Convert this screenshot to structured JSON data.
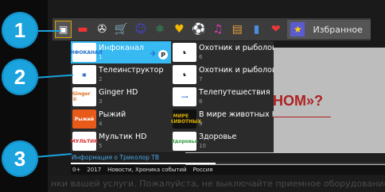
{
  "background": {
    "heading": "КОНОМ»?",
    "ticker": "нки вашей услуги. Пожалуйста, не выключайте приемное оборудование в тече"
  },
  "category_bar": {
    "items": [
      {
        "icon": "tv-icon",
        "glyph": "▣"
      },
      {
        "icon": "russia-flag-icon",
        "glyph": "▬"
      },
      {
        "icon": "film-reel-icon",
        "glyph": "✇"
      },
      {
        "icon": "shopping-cart-icon",
        "glyph": "🛒"
      },
      {
        "icon": "theater-mask-icon",
        "glyph": "☺"
      },
      {
        "icon": "atom-icon",
        "glyph": "⚛"
      },
      {
        "icon": "ice-cream-icon",
        "glyph": "♥"
      },
      {
        "icon": "soccer-ball-icon",
        "glyph": "⚽"
      },
      {
        "icon": "music-note-icon",
        "glyph": "♫"
      },
      {
        "icon": "briefcase-icon",
        "glyph": "▤"
      },
      {
        "icon": "bar-chart-icon",
        "glyph": "▮"
      },
      {
        "icon": "heart-icon",
        "glyph": "❤"
      }
    ],
    "favorites_label": "Избранное",
    "favorites_icon": "star-icon"
  },
  "channels": [
    {
      "name": "Инфоканал",
      "number": "1",
      "logo_text": "ИНФОКАНАЛ",
      "logo_icon": "infokanal-logo-icon",
      "logo_bg": "#ffffff",
      "logo_fg": "#2070d0",
      "selected": true
    },
    {
      "name": "Охотник и рыболов",
      "number": "6",
      "logo_text": "♞",
      "logo_icon": "ohotnik-logo-icon",
      "logo_bg": "#ffffff",
      "logo_fg": "#222222",
      "selected": false
    },
    {
      "name": "Телеинструктор",
      "number": "2",
      "logo_text": "▣",
      "logo_icon": "teleinstruktor-logo-icon",
      "logo_bg": "#ffffff",
      "logo_fg": "#1d5fbf",
      "selected": false
    },
    {
      "name": "Охотник и рыболов",
      "number": "7",
      "logo_text": "♞",
      "logo_icon": "ohotnik-logo-icon",
      "logo_bg": "#ffffff",
      "logo_fg": "#222222",
      "selected": false
    },
    {
      "name": "Ginger HD",
      "number": "3",
      "logo_text": "Ginger ©",
      "logo_icon": "ginger-logo-icon",
      "logo_bg": "#ffffff",
      "logo_fg": "#e07020",
      "selected": false
    },
    {
      "name": "Телепутешествия",
      "number": "8",
      "logo_text": "⟿",
      "logo_icon": "teleputeshestviya-logo-icon",
      "logo_bg": "#ffffff",
      "logo_fg": "#1d6fd0",
      "selected": false
    },
    {
      "name": "Рыжий",
      "number": "4",
      "logo_text": "Рыжий",
      "logo_icon": "ryzhiy-logo-icon",
      "logo_bg": "#e85a1a",
      "logo_fg": "#ffffff",
      "selected": false
    },
    {
      "name": "В мире животных Н",
      "number": "9",
      "logo_text": "В МИРЕ ЖИВОТНЫХ",
      "logo_icon": "v-mire-zhivotnyh-logo-icon",
      "logo_bg": "#111111",
      "logo_fg": "#e0b000",
      "selected": false
    },
    {
      "name": "Мультик HD",
      "number": "5",
      "logo_text": "МУЛЬТИК",
      "logo_icon": "multik-logo-icon",
      "logo_bg": "#ffffff",
      "logo_fg": "#d23030",
      "selected": false
    },
    {
      "name": "Здоровье",
      "number": "10",
      "logo_text": "Здоровье",
      "logo_icon": "zdorovye-logo-icon",
      "logo_bg": "#ffffff",
      "logo_fg": "#2a9a3a",
      "selected": false
    }
  ],
  "selected_badges": {
    "satellite_icon": "satellite-icon",
    "p_label": "P"
  },
  "info": {
    "title": "Информация о Триколор ТВ",
    "age": "0+",
    "year": "2017",
    "genre": "Новости, Хроника событий",
    "country": "Россия",
    "progress": 0.46
  },
  "callouts": [
    "1",
    "2",
    "3"
  ],
  "colors": {
    "accent": "#37b9f1",
    "callout": "#1aa3dd"
  }
}
